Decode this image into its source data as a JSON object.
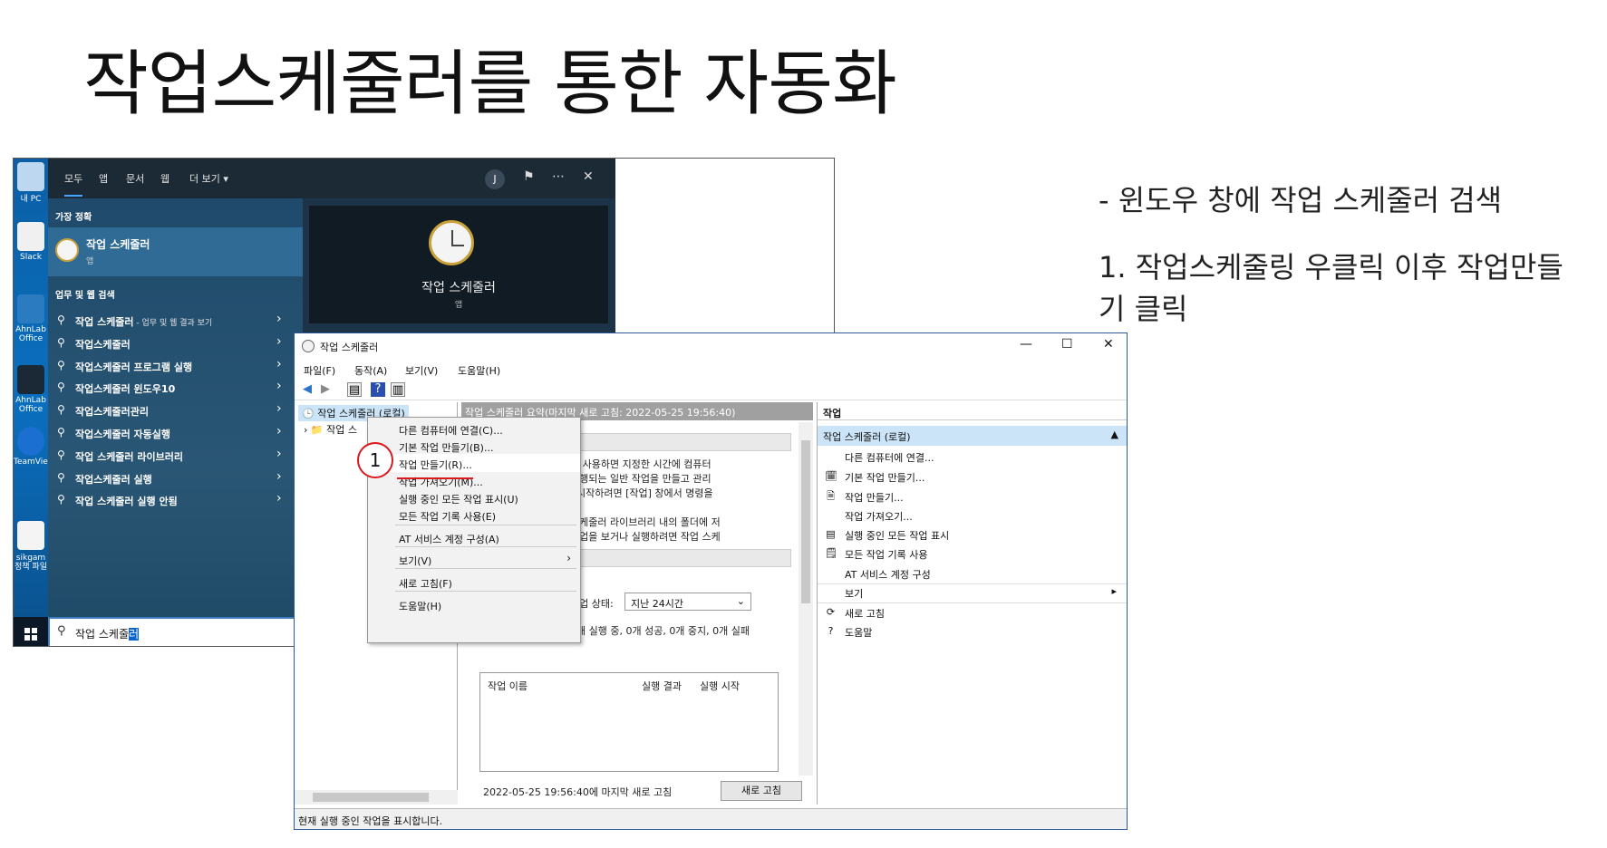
{
  "slide": {
    "title": "작업스케줄러를 통한 자동화",
    "notes": [
      "- 윈도우 창에 작업 스케줄러 검색",
      "1. 작업스케줄링 우클릭 이후 작업만들기 클릭"
    ]
  },
  "desktop": {
    "icons": [
      "내 PC",
      "Slack",
      "AhnLab Office",
      "AhnLab Office",
      "TeamViewer",
      "sikgam 정책 파일"
    ]
  },
  "start_menu": {
    "tabs": [
      "모두",
      "앱",
      "문서",
      "웹",
      "더 보기 ▾"
    ],
    "avatar": "J",
    "best_match_header": "가장 정확",
    "best_match": {
      "title": "작업 스케줄러",
      "subtitle": "앱"
    },
    "web_header": "업무 및 웹 검색",
    "results": [
      {
        "text": "작업 스케줄러",
        "suffix": " - 업무 및 웹 결과 보기"
      },
      {
        "text": "작업스케줄러",
        "suffix": ""
      },
      {
        "text": "작업스케줄러 프로그램 실행",
        "suffix": ""
      },
      {
        "text": "작업스케줄러 윈도우10",
        "suffix": ""
      },
      {
        "text": "작업스케줄러관리",
        "suffix": ""
      },
      {
        "text": "작업스케줄러 자동실행",
        "suffix": ""
      },
      {
        "text": "작업 스케줄러 라이브러리",
        "suffix": ""
      },
      {
        "text": "작업스케줄러 실행",
        "suffix": ""
      },
      {
        "text": "작업 스케줄러 실행 안됨",
        "suffix": ""
      }
    ],
    "search_value": "작업 스케줄",
    "search_selected": "러",
    "preview_title": "작업 스케줄러",
    "preview_sub": "앱"
  },
  "task_scheduler": {
    "title": "작업 스케줄러",
    "menu": [
      "파일(F)",
      "동작(A)",
      "보기(V)",
      "도움말(H)"
    ],
    "tree": [
      "작업 스케줄러 (로컬)",
      "작업 스"
    ],
    "center_header": "작업 스케줄러 요약(마지막 새로 고침: 2022-05-25 19:56:40)",
    "desc_lines": [
      "를 사용하면 지정한 시간에 컴퓨터",
      "수행되는 일반 작업을 만들고 관리",
      ". 시작하려면 [작업] 창에서 명령을",
      "스케줄러 라이브러리 내의 폴더에 저",
      "작업을 보거나 실행하려면 작업 스케"
    ],
    "status_label": "작업 상태:",
    "status_value": "지난 24시간",
    "status_summary": "0개 실행 중, 0개 성공, 0개 중지, 0개 실패",
    "table_headers": [
      "작업 이름",
      "실행 결과",
      "실행 시작"
    ],
    "refresh_time": "2022-05-25 19:56:40에 마지막 새로 고침",
    "refresh_button": "새로 고침",
    "actions_header": "작업",
    "actions_sub": "작업 스케줄러 (로컬)",
    "actions": [
      "다른 컴퓨터에 연결...",
      "기본 작업 만들기...",
      "작업 만들기...",
      "작업 가져오기...",
      "실행 중인 모든 작업 표시",
      "모든 작업 기록 사용",
      "AT 서비스 계정 구성",
      "보기",
      "새로 고침",
      "도움말"
    ],
    "statusbar": "현재 실행 중인 작업을 표시합니다."
  },
  "context_menu": {
    "items": [
      "다른 컴퓨터에 연결(C)...",
      "기본 작업 만들기(B)...",
      "작업 만들기(R)...",
      "작업 가져오기(M)...",
      "실행 중인 모든 작업 표시(U)",
      "모든 작업 기록 사용(E)",
      "AT 서비스 계정 구성(A)",
      "보기(V)",
      "새로 고침(F)",
      "도움말(H)"
    ],
    "step_marker": "1"
  },
  "colors": {
    "accent": "#2f6b94",
    "marker": "#d9191c",
    "selection": "#cce4f7"
  }
}
